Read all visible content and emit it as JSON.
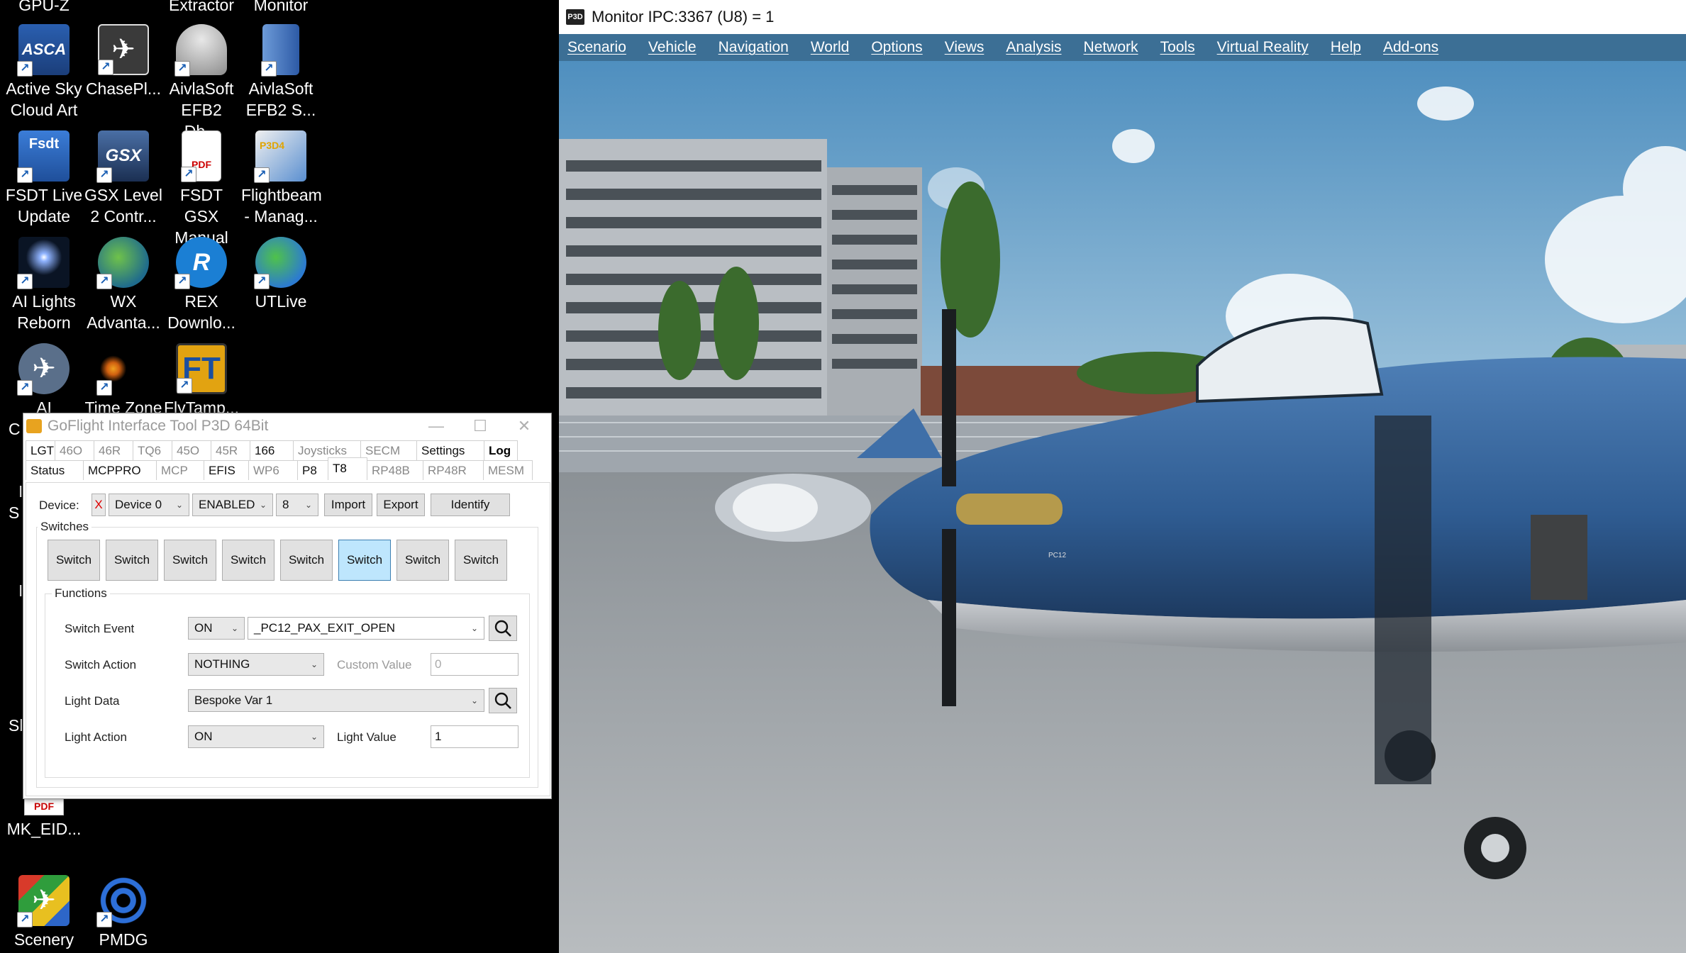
{
  "desktop": {
    "top_labels": [
      "GPU-Z",
      "Extractor",
      "Monitor"
    ],
    "icons": [
      {
        "label": "Active Sky\nCloud Art",
        "icon": "asca-icon",
        "glyph": "ASCA"
      },
      {
        "label": "ChasePl...",
        "icon": "chaseplane-icon",
        "glyph": "✈"
      },
      {
        "label": "AivlaSoft\nEFB2 Db...",
        "icon": "database-icon",
        "glyph": ""
      },
      {
        "label": "AivlaSoft\nEFB2 S...",
        "icon": "server-icon",
        "glyph": ""
      },
      {
        "label": "FSDT Live\nUpdate",
        "icon": "fsdt-icon",
        "glyph": "Fsdt"
      },
      {
        "label": "GSX Level\n2 Contr...",
        "icon": "gsx-icon",
        "glyph": "GSX"
      },
      {
        "label": "FSDT GSX\nManual",
        "icon": "pdf-icon",
        "glyph": "PDF"
      },
      {
        "label": "Flightbeam\n- Manag...",
        "icon": "flightbeam-icon",
        "glyph": "P3D4"
      },
      {
        "label": "AI Lights\nReborn",
        "icon": "ai-lights-icon",
        "glyph": ""
      },
      {
        "label": "WX\nAdvanta...",
        "icon": "wx-globe-icon",
        "glyph": ""
      },
      {
        "label": "REX\nDownlo...",
        "icon": "rex-icon",
        "glyph": "R"
      },
      {
        "label": "UTLive",
        "icon": "utlive-icon",
        "glyph": ""
      },
      {
        "label": "AI",
        "icon": "ai-plane-icon",
        "glyph": "✈"
      },
      {
        "label": "Time Zone",
        "icon": "timezone-icon",
        "glyph": ""
      },
      {
        "label": "FlyTamp...",
        "icon": "flytampa-icon",
        "glyph": "FT"
      },
      {
        "label": "MK_EID...",
        "icon": "pdf-icon",
        "glyph": "PDF"
      },
      {
        "label": "Scenery",
        "icon": "scenery-icon",
        "glyph": "✈"
      },
      {
        "label": "PMDG",
        "icon": "pmdg-icon",
        "glyph": ""
      }
    ],
    "partial_letters": [
      "C",
      "I",
      "S",
      "I",
      "Sl"
    ]
  },
  "p3d": {
    "title": "Monitor IPC:3367 (U8) = 1",
    "logo": "P3D",
    "menu": [
      "Scenario",
      "Vehicle",
      "Navigation",
      "World",
      "Options",
      "Views",
      "Analysis",
      "Network",
      "Tools",
      "Virtual Reality",
      "Help",
      "Add-ons"
    ],
    "aircraft_tail_label": "PC12"
  },
  "goflight": {
    "title": "GoFlight Interface Tool P3D 64Bit",
    "tabs_row1": [
      "LGT",
      "46O",
      "46R",
      "TQ6",
      "45O",
      "45R",
      "166",
      "Joysticks",
      "SECM",
      "Settings",
      "Log"
    ],
    "tabs_row2": [
      "Status",
      "MCPPRO",
      "MCP",
      "EFIS",
      "WP6",
      "P8",
      "T8",
      "RP48B",
      "RP48R",
      "MESM"
    ],
    "device_label": "Device:",
    "device_x": "X",
    "device_select": "Device 0",
    "enabled_select": "ENABLED",
    "count_select": "8",
    "import_label": "Import",
    "export_label": "Export",
    "identify_label": "Identify",
    "switches_title": "Switches",
    "switches": [
      "Switch",
      "Switch",
      "Switch",
      "Switch",
      "Switch",
      "Switch",
      "Switch",
      "Switch"
    ],
    "active_switch_index": 5,
    "functions_title": "Functions",
    "switch_event_label": "Switch Event",
    "switch_event_state": "ON",
    "switch_event_value": "_PC12_PAX_EXIT_OPEN",
    "switch_action_label": "Switch Action",
    "switch_action_value": "NOTHING",
    "custom_value_label": "Custom Value",
    "custom_value": "0",
    "light_data_label": "Light Data",
    "light_data_value": "Bespoke Var 1",
    "light_action_label": "Light Action",
    "light_action_value": "ON",
    "light_value_label": "Light Value",
    "light_value": "1"
  }
}
